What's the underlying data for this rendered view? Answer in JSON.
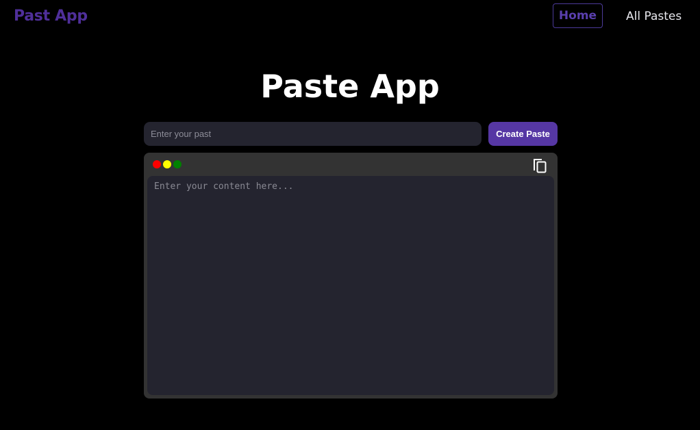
{
  "nav": {
    "brand": "Past App",
    "links": [
      {
        "label": "Home",
        "active": true
      },
      {
        "label": "All Pastes",
        "active": false
      }
    ]
  },
  "main": {
    "title": "Paste App",
    "title_input": {
      "value": "",
      "placeholder": "Enter your past"
    },
    "create_button_label": "Create Paste",
    "editor": {
      "window_dots": [
        {
          "name": "red",
          "color": "#ff0000"
        },
        {
          "name": "yellow",
          "color": "#ffff00"
        },
        {
          "name": "green",
          "color": "#008000"
        }
      ],
      "copy_icon": "copy-icon",
      "content_value": "",
      "content_placeholder": "Enter your content here..."
    }
  },
  "colors": {
    "background": "#000000",
    "brand": "#4f2f9a",
    "accent": "#5637a4",
    "input_bg": "#24242f",
    "editor_frame": "#333333"
  }
}
